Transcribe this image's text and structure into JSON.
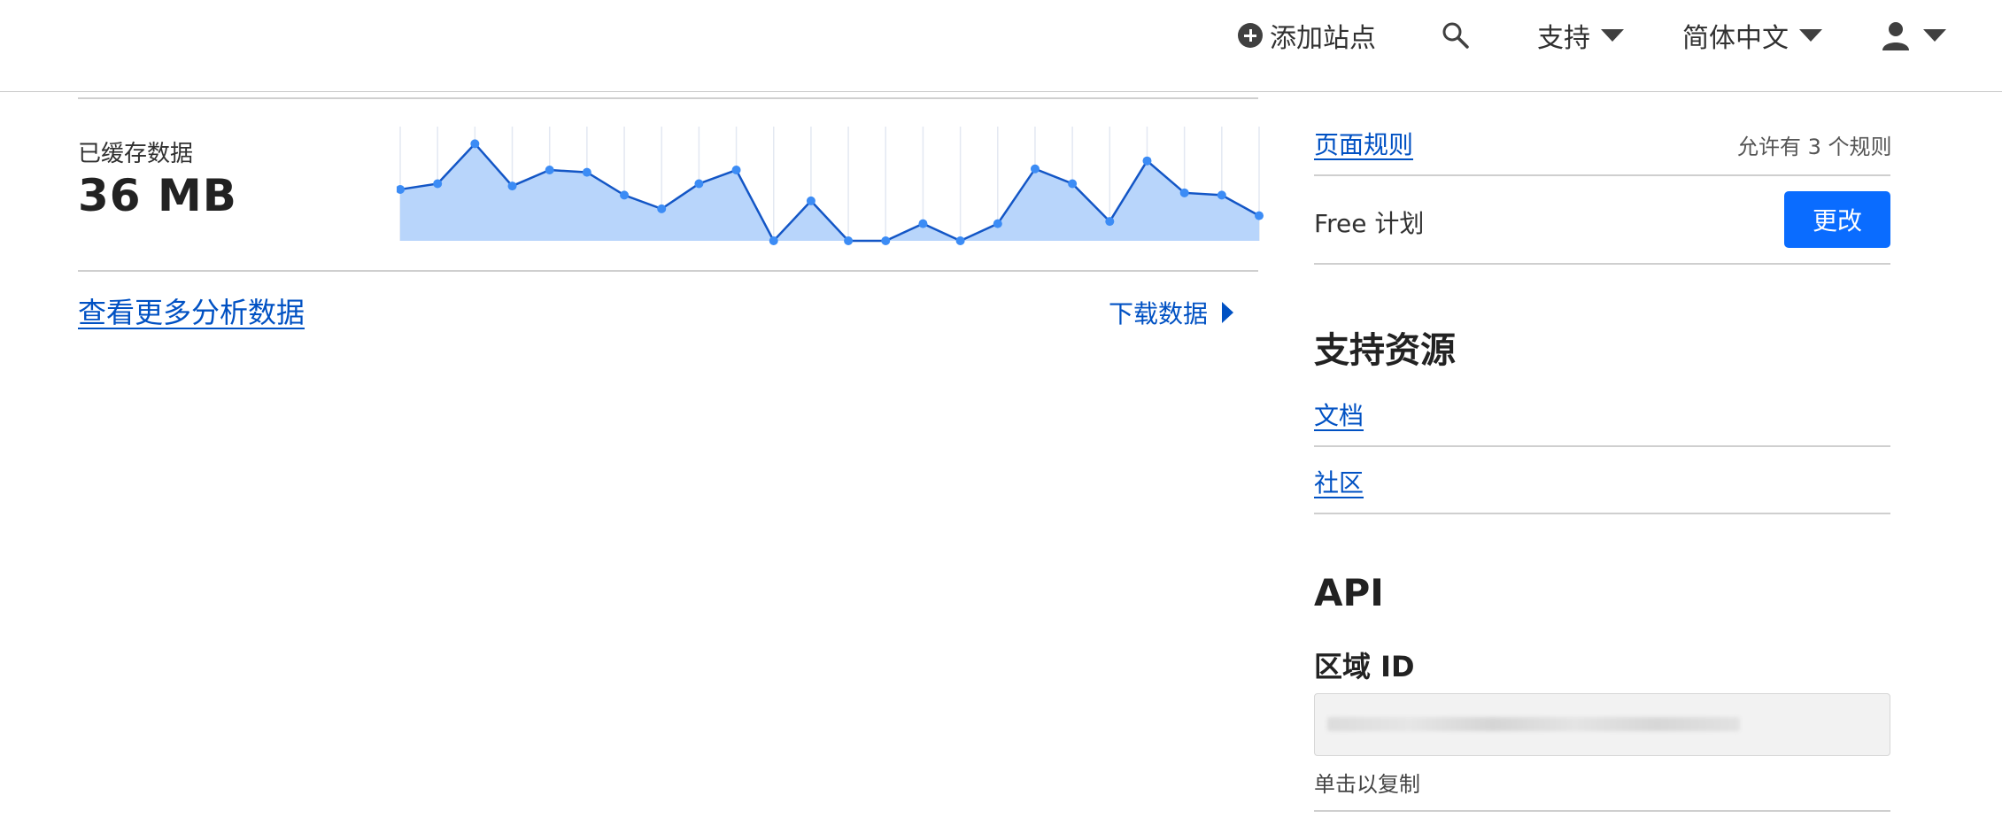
{
  "header": {
    "add_site": "添加站点",
    "support": "支持",
    "language": "简体中文"
  },
  "analytics": {
    "cached_label": "已缓存数据",
    "cached_value": "36 MB",
    "more_link": "查看更多分析数据",
    "download_link": "下载数据"
  },
  "chart_data": {
    "type": "area",
    "values": [
      0.45,
      0.5,
      0.85,
      0.48,
      0.62,
      0.6,
      0.4,
      0.28,
      0.5,
      0.62,
      0.0,
      0.35,
      0.0,
      0.0,
      0.15,
      0.0,
      0.15,
      0.63,
      0.5,
      0.17,
      0.7,
      0.42,
      0.4,
      0.22
    ],
    "line_color": "#1356c6",
    "fill_color": "#b8d5fb",
    "point_color": "#3c8cf5",
    "grid": true
  },
  "sidebar": {
    "page_rules_link": "页面规则",
    "page_rules_quota": "允许有 3 个规则",
    "plan_label": "Free 计划",
    "change_button": "更改",
    "support_heading": "支持资源",
    "docs_link": "文档",
    "community_link": "社区",
    "api_heading": "API",
    "zone_id_label": "区域 ID",
    "copy_hint": "单击以复制"
  }
}
